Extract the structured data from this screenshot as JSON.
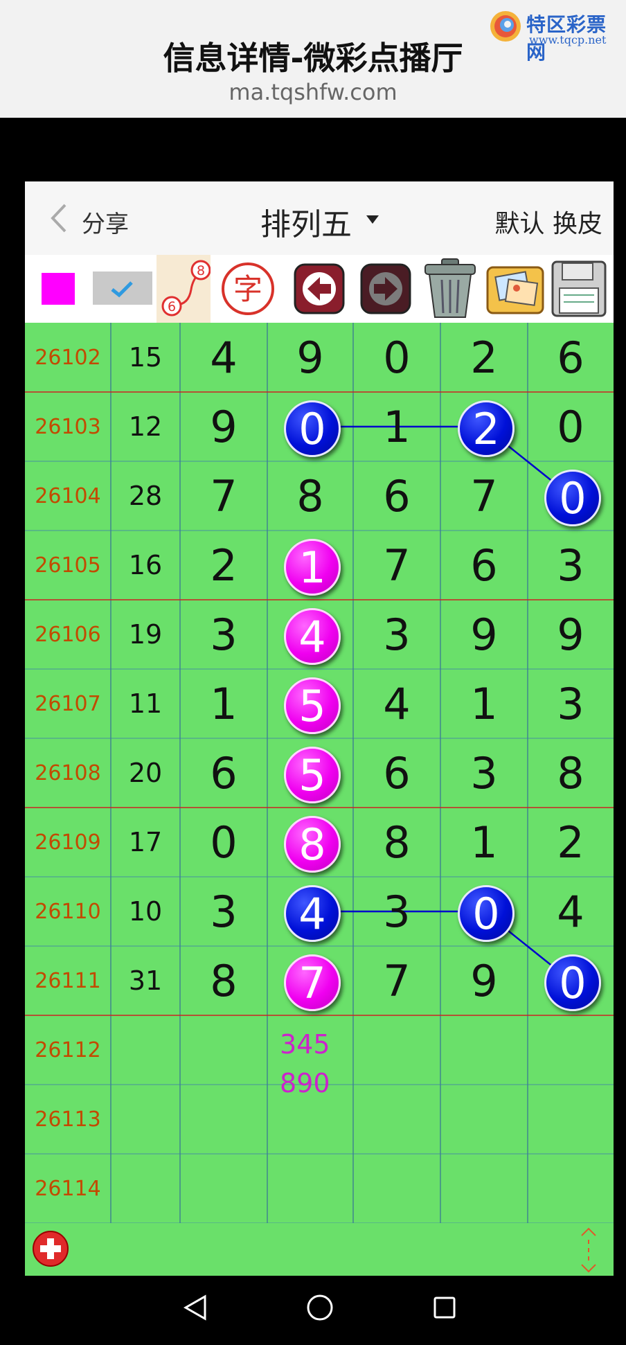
{
  "header": {
    "title": "信息详情-微彩点播厅",
    "url": "ma.tqshfw.com"
  },
  "logo": {
    "name": "特区彩票网",
    "domain": "www.tqcp.net"
  },
  "nav": {
    "back_icon": "chevron-left-icon",
    "share_label": "分享",
    "title": "排列五",
    "skin_label": "默认 换皮"
  },
  "toolbar": {
    "color_swatch": "#ff00ff",
    "items": [
      "color-swatch",
      "check-icon",
      "route-icon",
      "zi-icon",
      "arrow-left-icon",
      "arrow-right-icon",
      "trash-icon",
      "photo-icon",
      "save-icon"
    ],
    "route_digits": [
      "8",
      "6"
    ],
    "zi_char": "字"
  },
  "rows": [
    {
      "issue": "26102",
      "sum": "15",
      "digits": [
        "4",
        "9",
        "0",
        "2",
        "6"
      ]
    },
    {
      "issue": "26103",
      "sum": "12",
      "digits": [
        "9",
        "0",
        "1",
        "2",
        "0"
      ]
    },
    {
      "issue": "26104",
      "sum": "28",
      "digits": [
        "7",
        "8",
        "6",
        "7",
        "0"
      ]
    },
    {
      "issue": "26105",
      "sum": "16",
      "digits": [
        "2",
        "1",
        "7",
        "6",
        "3"
      ]
    },
    {
      "issue": "26106",
      "sum": "19",
      "digits": [
        "3",
        "4",
        "3",
        "9",
        "9"
      ]
    },
    {
      "issue": "26107",
      "sum": "11",
      "digits": [
        "1",
        "5",
        "4",
        "1",
        "3"
      ]
    },
    {
      "issue": "26108",
      "sum": "20",
      "digits": [
        "6",
        "5",
        "6",
        "3",
        "8"
      ]
    },
    {
      "issue": "26109",
      "sum": "17",
      "digits": [
        "0",
        "8",
        "8",
        "1",
        "2"
      ]
    },
    {
      "issue": "26110",
      "sum": "10",
      "digits": [
        "3",
        "4",
        "3",
        "0",
        "4"
      ]
    },
    {
      "issue": "26111",
      "sum": "31",
      "digits": [
        "8",
        "7",
        "7",
        "9",
        "0"
      ]
    },
    {
      "issue": "26112",
      "sum": "",
      "digits": [
        "",
        "",
        "",
        "",
        ""
      ]
    },
    {
      "issue": "26113",
      "sum": "",
      "digits": [
        "",
        "",
        "",
        "",
        ""
      ]
    },
    {
      "issue": "26114",
      "sum": "",
      "digits": [
        "",
        "",
        "",
        "",
        ""
      ]
    }
  ],
  "highlights": [
    {
      "row": 1,
      "col": 1,
      "color": "blue"
    },
    {
      "row": 1,
      "col": 3,
      "color": "blue"
    },
    {
      "row": 2,
      "col": 4,
      "color": "blue"
    },
    {
      "row": 3,
      "col": 1,
      "color": "magenta"
    },
    {
      "row": 4,
      "col": 1,
      "color": "magenta"
    },
    {
      "row": 5,
      "col": 1,
      "color": "magenta"
    },
    {
      "row": 6,
      "col": 1,
      "color": "magenta"
    },
    {
      "row": 7,
      "col": 1,
      "color": "magenta"
    },
    {
      "row": 8,
      "col": 1,
      "color": "blue"
    },
    {
      "row": 8,
      "col": 3,
      "color": "blue"
    },
    {
      "row": 9,
      "col": 1,
      "color": "magenta"
    },
    {
      "row": 9,
      "col": 4,
      "color": "blue"
    }
  ],
  "connections": [
    [
      [
        1,
        1
      ],
      [
        1,
        3
      ],
      [
        2,
        4
      ]
    ],
    [
      [
        8,
        1
      ],
      [
        8,
        3
      ],
      [
        9,
        4
      ]
    ]
  ],
  "prediction": {
    "row": 10,
    "col": 1,
    "lines": [
      "345",
      "890"
    ]
  },
  "colors": {
    "grid_bg": "#6ae06a",
    "issue_text": "#c24a00",
    "prediction": "#cc22cc",
    "blue_ball": "#0010d8",
    "magenta_ball": "#f000f0",
    "line_blue": "#0000cc",
    "separator_red": "#cc2222"
  },
  "bottom": {
    "add_icon": "plus-circle-icon",
    "scroll_icon": "updown-arrows-icon"
  },
  "system_nav": [
    "back-triangle-icon",
    "home-circle-icon",
    "recents-square-icon"
  ]
}
